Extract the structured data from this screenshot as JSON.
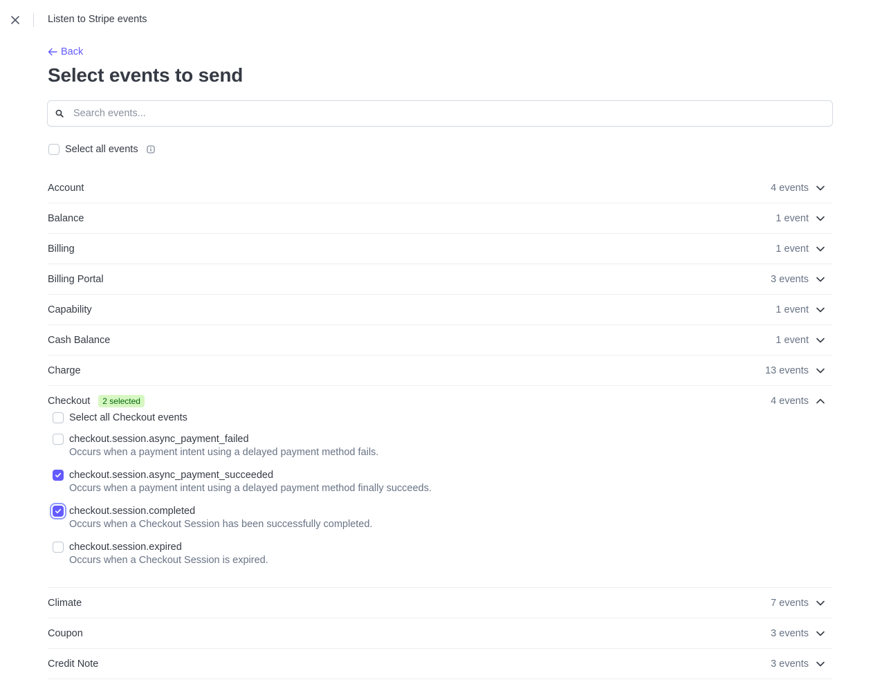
{
  "header": {
    "title": "Listen to Stripe events"
  },
  "back_label": "Back",
  "page_title": "Select events to send",
  "search": {
    "placeholder": "Search events..."
  },
  "select_all_label": "Select all events",
  "groups": [
    {
      "name": "Account",
      "count": "4 events"
    },
    {
      "name": "Balance",
      "count": "1 event"
    },
    {
      "name": "Billing",
      "count": "1 event"
    },
    {
      "name": "Billing Portal",
      "count": "3 events"
    },
    {
      "name": "Capability",
      "count": "1 event"
    },
    {
      "name": "Cash Balance",
      "count": "1 event"
    },
    {
      "name": "Charge",
      "count": "13 events"
    }
  ],
  "checkout": {
    "name": "Checkout",
    "badge": "2 selected",
    "count": "4 events",
    "select_all_label": "Select all Checkout events",
    "events": [
      {
        "name": "checkout.session.async_payment_failed",
        "desc": "Occurs when a payment intent using a delayed payment method fails.",
        "checked": false
      },
      {
        "name": "checkout.session.async_payment_succeeded",
        "desc": "Occurs when a payment intent using a delayed payment method finally succeeds.",
        "checked": true
      },
      {
        "name": "checkout.session.completed",
        "desc": "Occurs when a Checkout Session has been successfully completed.",
        "checked": true
      },
      {
        "name": "checkout.session.expired",
        "desc": "Occurs when a Checkout Session is expired.",
        "checked": false
      }
    ]
  },
  "groups_after": [
    {
      "name": "Climate",
      "count": "7 events"
    },
    {
      "name": "Coupon",
      "count": "3 events"
    },
    {
      "name": "Credit Note",
      "count": "3 events"
    }
  ],
  "colors": {
    "accent": "#635bff",
    "badge_bg": "#d7f7c2",
    "badge_text": "#006908"
  }
}
